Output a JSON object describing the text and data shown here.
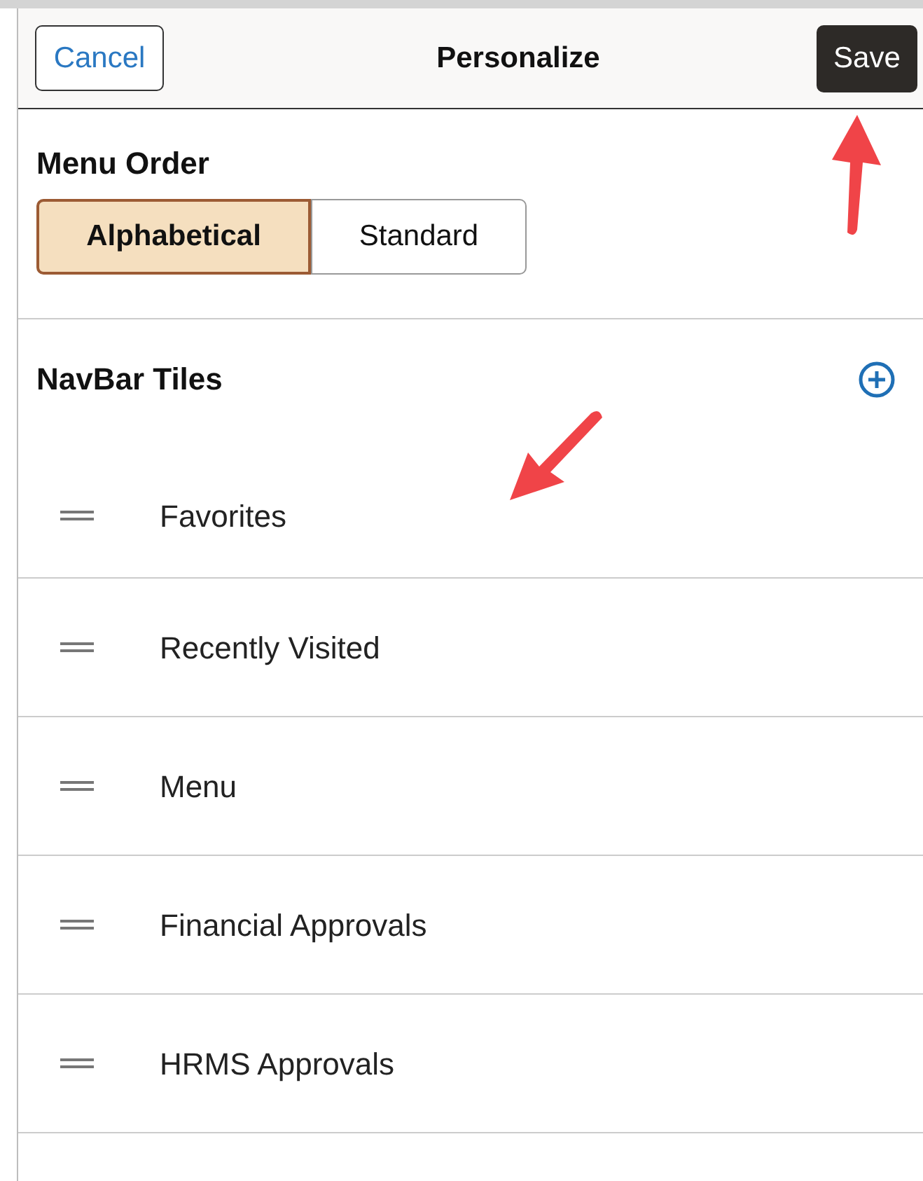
{
  "header": {
    "cancel": "Cancel",
    "title": "Personalize",
    "save": "Save"
  },
  "menu_order": {
    "label": "Menu Order",
    "options": [
      {
        "label": "Alphabetical",
        "selected": true
      },
      {
        "label": "Standard",
        "selected": false
      }
    ]
  },
  "navbar_tiles": {
    "label": "NavBar Tiles",
    "items": [
      {
        "label": "Favorites"
      },
      {
        "label": "Recently Visited"
      },
      {
        "label": "Menu"
      },
      {
        "label": "Financial Approvals"
      },
      {
        "label": "HRMS Approvals"
      }
    ]
  }
}
